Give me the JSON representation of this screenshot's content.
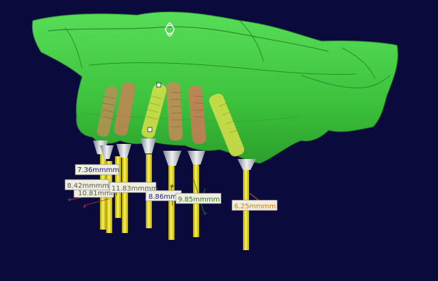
{
  "viewport": {
    "background": "#0a0a3c",
    "bone_color": "#3fcf3f",
    "implant_colors": [
      "#c98a5a",
      "#d9e04a"
    ],
    "pin_color": "#e6e01a",
    "sleeve_color": "#bfc3c8"
  },
  "measurements": [
    {
      "label": "7.36mmmm",
      "text_color": "#1a1a8a"
    },
    {
      "label": "8.42mmmm",
      "text_color": "#555555"
    },
    {
      "label": "10.81mmm",
      "text_color": "#555555"
    },
    {
      "label": "11.83mmmm",
      "text_color": "#555555"
    },
    {
      "label": "8.86mm",
      "text_color": "#1a1a8a"
    },
    {
      "label": "9.85mmmm",
      "text_color": "#2a7a2a"
    },
    {
      "label": "6.25mmmm",
      "text_color": "#e07a00"
    }
  ],
  "icons": {
    "rotate_handle": "rotate-handle-icon"
  }
}
